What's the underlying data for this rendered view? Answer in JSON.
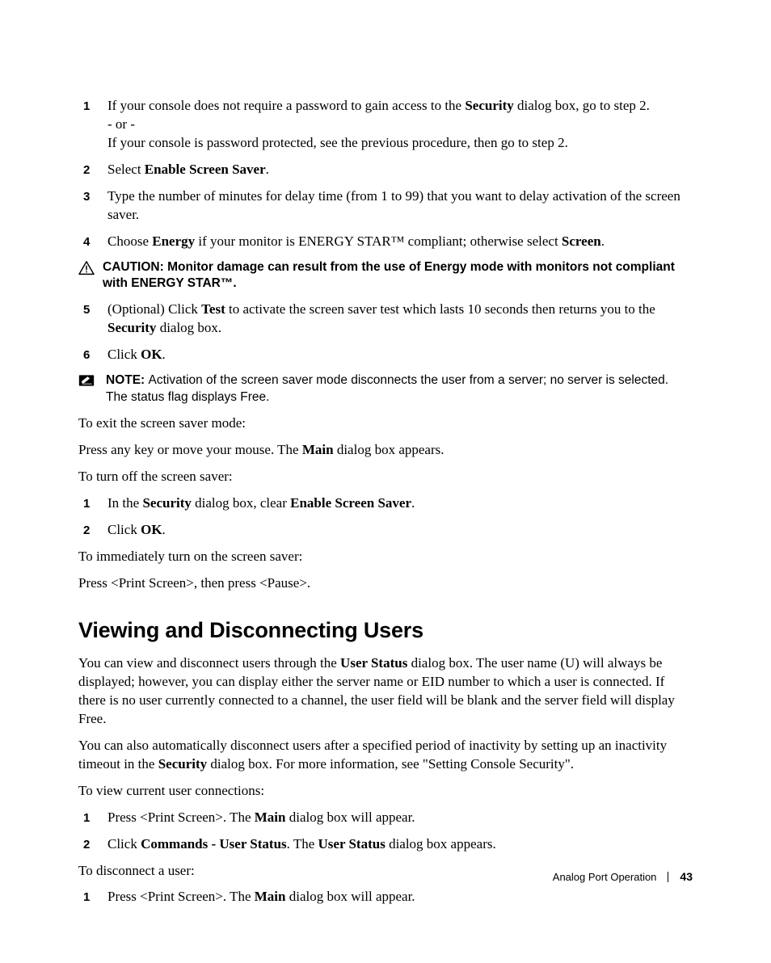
{
  "listA": {
    "items": [
      {
        "num": "1",
        "parts": [
          {
            "t": "plain",
            "v": "If your console does not require a password to gain access to the "
          },
          {
            "t": "bold",
            "v": "Security"
          },
          {
            "t": "plain",
            "v": " dialog box, go to step 2."
          },
          {
            "t": "br"
          },
          {
            "t": "plain",
            "v": "- or -"
          },
          {
            "t": "br"
          },
          {
            "t": "plain",
            "v": "If your console is password protected, see the previous procedure, then go to step 2."
          }
        ]
      },
      {
        "num": "2",
        "parts": [
          {
            "t": "plain",
            "v": "Select "
          },
          {
            "t": "bold",
            "v": "Enable Screen Saver"
          },
          {
            "t": "plain",
            "v": "."
          }
        ]
      },
      {
        "num": "3",
        "parts": [
          {
            "t": "plain",
            "v": "Type the number of minutes for delay time (from 1 to 99) that you want to delay activation of the screen saver."
          }
        ]
      },
      {
        "num": "4",
        "parts": [
          {
            "t": "plain",
            "v": "Choose "
          },
          {
            "t": "bold",
            "v": "Energy"
          },
          {
            "t": "plain",
            "v": " if your monitor is ENERGY STAR™ compliant; otherwise select "
          },
          {
            "t": "bold",
            "v": "Screen"
          },
          {
            "t": "plain",
            "v": "."
          }
        ]
      }
    ]
  },
  "caution": {
    "label": "CAUTION: ",
    "body": "Monitor damage can result from the use of Energy mode with monitors not compliant with ENERGY STAR™."
  },
  "listB": {
    "items": [
      {
        "num": "5",
        "parts": [
          {
            "t": "plain",
            "v": "(Optional) Click "
          },
          {
            "t": "bold",
            "v": "Test"
          },
          {
            "t": "plain",
            "v": " to activate the screen saver test which lasts 10 seconds then returns you to the "
          },
          {
            "t": "bold",
            "v": "Security"
          },
          {
            "t": "plain",
            "v": " dialog box."
          }
        ]
      },
      {
        "num": "6",
        "parts": [
          {
            "t": "plain",
            "v": "Click "
          },
          {
            "t": "bold",
            "v": "OK"
          },
          {
            "t": "plain",
            "v": "."
          }
        ]
      }
    ]
  },
  "note": {
    "label": "NOTE: ",
    "body": "Activation of the screen saver mode disconnects the user from a server; no server is selected. The status flag displays Free."
  },
  "para1": "To exit the screen saver mode:",
  "para2": {
    "parts": [
      {
        "t": "plain",
        "v": "Press any key or move your mouse. The "
      },
      {
        "t": "bold",
        "v": "Main"
      },
      {
        "t": "plain",
        "v": " dialog box appears."
      }
    ]
  },
  "para3": "To turn off the screen saver:",
  "listC": {
    "items": [
      {
        "num": "1",
        "parts": [
          {
            "t": "plain",
            "v": "In the "
          },
          {
            "t": "bold",
            "v": "Security"
          },
          {
            "t": "plain",
            "v": " dialog box, clear "
          },
          {
            "t": "bold",
            "v": "Enable Screen Saver"
          },
          {
            "t": "plain",
            "v": "."
          }
        ]
      },
      {
        "num": "2",
        "parts": [
          {
            "t": "plain",
            "v": "Click "
          },
          {
            "t": "bold",
            "v": "OK"
          },
          {
            "t": "plain",
            "v": "."
          }
        ]
      }
    ]
  },
  "para4": "To immediately turn on the screen saver:",
  "para5": "Press <Print Screen>, then press <Pause>.",
  "heading": "Viewing and Disconnecting Users",
  "para6": {
    "parts": [
      {
        "t": "plain",
        "v": "You can view and disconnect users through the "
      },
      {
        "t": "bold",
        "v": "User Status"
      },
      {
        "t": "plain",
        "v": " dialog box. The user name (U) will always be displayed; however, you can display either the server name or EID number to which a user is connected. If there is no user currently connected to a channel, the user field will be blank and the server field will display Free."
      }
    ]
  },
  "para7": {
    "parts": [
      {
        "t": "plain",
        "v": "You can also automatically disconnect users after a specified period of inactivity by setting up an inactivity timeout in the "
      },
      {
        "t": "bold",
        "v": "Security"
      },
      {
        "t": "plain",
        "v": " dialog box. For more information, see \"Setting Console Security\"."
      }
    ]
  },
  "para8": "To view current user connections:",
  "listD": {
    "items": [
      {
        "num": "1",
        "parts": [
          {
            "t": "plain",
            "v": "Press <Print Screen>. The "
          },
          {
            "t": "bold",
            "v": "Main"
          },
          {
            "t": "plain",
            "v": " dialog box will appear."
          }
        ]
      },
      {
        "num": "2",
        "parts": [
          {
            "t": "plain",
            "v": "Click "
          },
          {
            "t": "bold",
            "v": "Commands - User Status"
          },
          {
            "t": "plain",
            "v": ". The "
          },
          {
            "t": "bold",
            "v": "User Status"
          },
          {
            "t": "plain",
            "v": " dialog box appears."
          }
        ]
      }
    ]
  },
  "para9": "To disconnect a user:",
  "listE": {
    "items": [
      {
        "num": "1",
        "parts": [
          {
            "t": "plain",
            "v": "Press <Print Screen>. The "
          },
          {
            "t": "bold",
            "v": "Main"
          },
          {
            "t": "plain",
            "v": " dialog box will appear."
          }
        ]
      }
    ]
  },
  "footer": {
    "section": "Analog Port Operation",
    "page": "43"
  }
}
